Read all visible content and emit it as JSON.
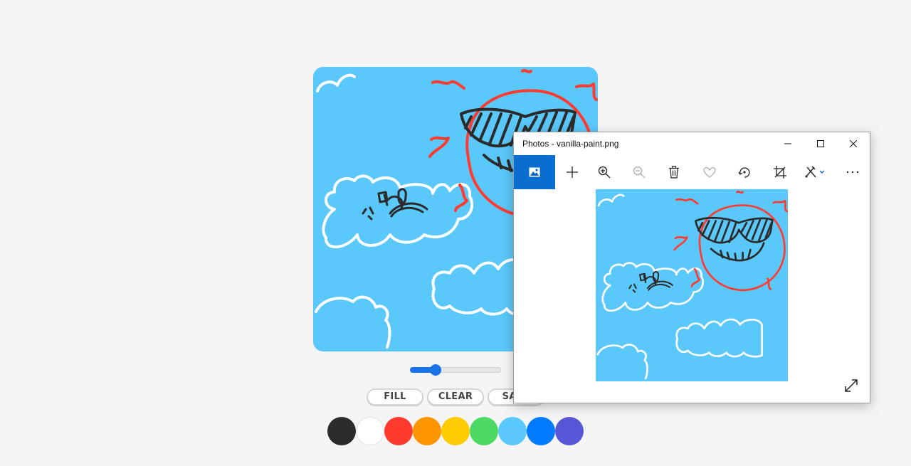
{
  "paint_app": {
    "brush_size": 0.28,
    "buttons": {
      "fill": "FILL",
      "clear": "CLEAR",
      "save": "SAVE"
    },
    "colors": [
      "#2b2b2b",
      "#ffffff",
      "#ff3b30",
      "#ff9500",
      "#ffcc00",
      "#4cd964",
      "#5ac8fa",
      "#007aff",
      "#5856d6"
    ]
  },
  "photos_window": {
    "title": "Photos - vanilla-paint.png",
    "toolbar": [
      "image-icon",
      "add-icon",
      "zoom-in-icon",
      "zoom-out-icon",
      "delete-icon",
      "favorite-icon",
      "rotate-icon",
      "crop-icon",
      "edit-icon",
      "more-icon"
    ]
  },
  "accent_color": "#0a6ed1"
}
